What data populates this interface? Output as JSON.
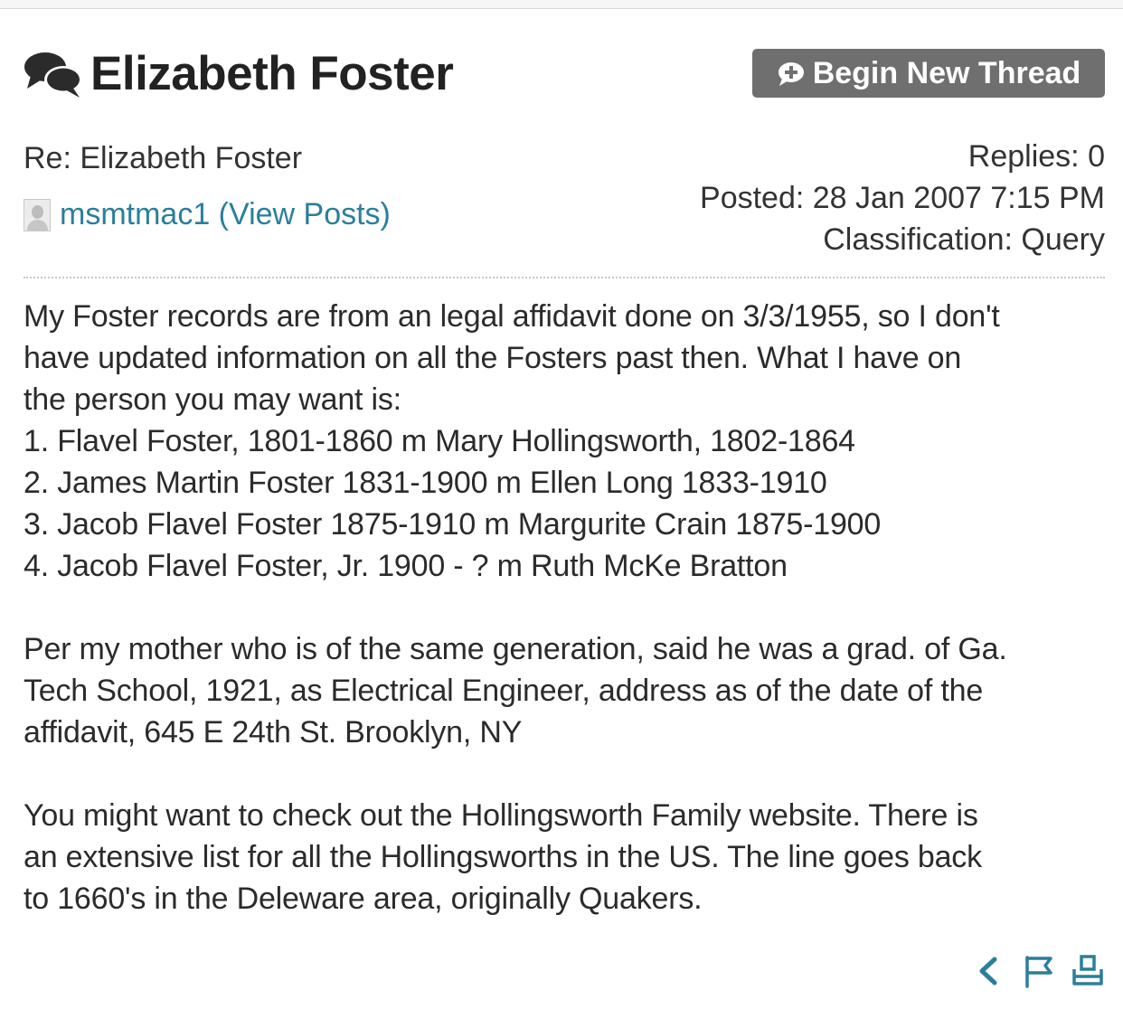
{
  "thread": {
    "title": "Elizabeth Foster",
    "new_thread_label": "Begin New Thread"
  },
  "post": {
    "subject": "Re: Elizabeth Foster",
    "author": "msmtmac1 (View Posts)",
    "replies": "Replies: 0",
    "posted": "Posted: 28 Jan 2007 7:15 PM",
    "classification": "Classification: Query",
    "body_lines": [
      "My Foster records are from an legal affidavit done on 3/3/1955, so I don't",
      "have updated information on all the Fosters past then.  What I have on",
      "the person you may want is:",
      "1. Flavel Foster, 1801-1860 m Mary Hollingsworth, 1802-1864",
      "2. James Martin Foster 1831-1900 m Ellen Long 1833-1910",
      "3. Jacob Flavel Foster 1875-1910 m Margurite Crain 1875-1900",
      "4. Jacob Flavel Foster, Jr. 1900 - ? m Ruth McKe Bratton",
      "Per my mother who is of the same generation, said he was a grad. of Ga.",
      "Tech School, 1921, as Electrical Engineer, address as of the date of the",
      "affidavit, 645 E 24th St. Brooklyn, NY",
      "You might want to check out the Hollingsworth Family website.  There is",
      "an extensive list for all the Hollingsworths in the US.  The line goes back",
      "to 1660's in the Deleware area, originally Quakers."
    ]
  },
  "icons": {
    "title": "speech-bubbles-icon",
    "button": "comment-plus-icon",
    "actions": [
      "back-arrow-icon",
      "flag-icon",
      "print-icon"
    ]
  },
  "colors": {
    "link": "#2a7f9c",
    "button_bg": "#6f6f6f",
    "text": "#2b2b2b"
  }
}
